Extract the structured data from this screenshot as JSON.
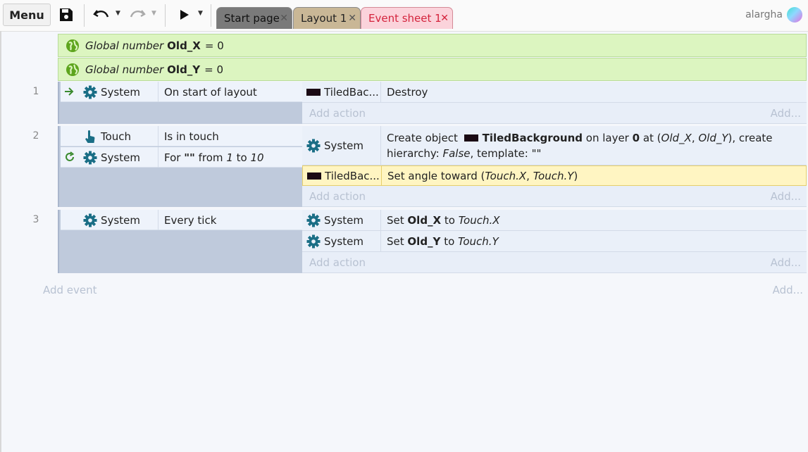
{
  "toolbar": {
    "menu_label": "Menu",
    "tabs": [
      {
        "label": "Start page",
        "color": "#7a7a7a"
      },
      {
        "label": "Layout 1",
        "color": "#c9b796"
      },
      {
        "label": "Event sheet 1",
        "color": "#fbd3db"
      }
    ],
    "tab_close": "✕",
    "user_name": "alargha"
  },
  "globals": [
    {
      "kind": "Global number",
      "name": "Old_X",
      "eq": "= 0"
    },
    {
      "kind": "Global number",
      "name": "Old_Y",
      "eq": "= 0"
    }
  ],
  "events": [
    {
      "number": "1",
      "conditions": [
        {
          "object": "System",
          "text": "On start of layout",
          "prefix_icon": "trigger-arrow-icon"
        }
      ],
      "actions": [
        {
          "object": "TiledBac...",
          "text": "Destroy"
        }
      ]
    },
    {
      "number": "2",
      "conditions": [
        {
          "object": "Touch",
          "text": "Is in touch",
          "icon": "touch-hand-icon"
        },
        {
          "object": "System",
          "text_parts": [
            "For ",
            "\"\"",
            " from ",
            "1",
            " to ",
            "10"
          ],
          "prefix_icon": "loop-icon"
        }
      ],
      "actions": [
        {
          "object": "System",
          "text_parts": [
            "Create object ",
            "TiledBackground",
            " on layer ",
            "0",
            " at (",
            "Old_X",
            ", ",
            "Old_Y",
            "), create hierarchy: ",
            "False",
            ", template: \"\""
          ]
        },
        {
          "object": "TiledBac...",
          "text_parts": [
            "Set angle toward (",
            "Touch.X",
            ", ",
            "Touch.Y",
            ")"
          ],
          "highlighted": true
        }
      ]
    },
    {
      "number": "3",
      "conditions": [
        {
          "object": "System",
          "text": "Every tick"
        }
      ],
      "actions": [
        {
          "object": "System",
          "text_parts": [
            "Set ",
            "Old_X",
            " to ",
            "Touch.X"
          ]
        },
        {
          "object": "System",
          "text_parts": [
            "Set ",
            "Old_Y",
            " to ",
            "Touch.Y"
          ]
        }
      ]
    }
  ],
  "add_action_label": "Add action",
  "add_more_label": "Add...",
  "add_event_label": "Add event",
  "colors": {
    "gear": "#1a6e86",
    "global_bg": "#dcf5c0",
    "highlight": "#fff5c2"
  }
}
